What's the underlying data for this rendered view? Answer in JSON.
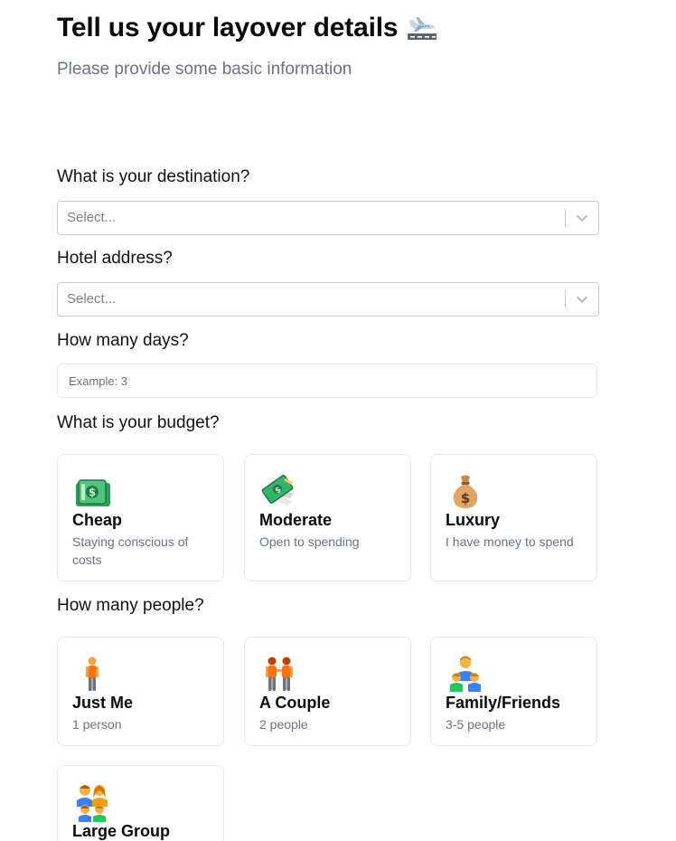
{
  "header": {
    "title": "Tell us your layover details",
    "title_icon": "airplane-departure-icon",
    "subtitle": "Please provide some basic information"
  },
  "destination": {
    "label": "What is your destination?",
    "placeholder": "Select..."
  },
  "hotel": {
    "label": "Hotel address?",
    "placeholder": "Select..."
  },
  "days": {
    "label": "How many days?",
    "placeholder": "Example: 3",
    "value": ""
  },
  "budget": {
    "label": "What is your budget?",
    "options": [
      {
        "title": "Cheap",
        "desc": "Staying conscious of costs",
        "icon": "dollar-banknote-icon"
      },
      {
        "title": "Moderate",
        "desc": "Open to spending",
        "icon": "money-with-wings-icon"
      },
      {
        "title": "Luxury",
        "desc": "I have money to spend",
        "icon": "money-bag-icon"
      }
    ]
  },
  "people": {
    "label": "How many people?",
    "options": [
      {
        "title": "Just Me",
        "desc": "1 person",
        "icon": "person-standing-icon"
      },
      {
        "title": "A Couple",
        "desc": "2 people",
        "icon": "two-people-icon"
      },
      {
        "title": "Family/Friends",
        "desc": "3-5 people",
        "icon": "family-icon"
      },
      {
        "title": "Large Group",
        "desc": "",
        "icon": "group-icon"
      }
    ]
  },
  "colors": {
    "text": "#0b0b0b",
    "muted": "#6b7280",
    "border": "#e5e7eb",
    "select_border": "#cccccc"
  }
}
